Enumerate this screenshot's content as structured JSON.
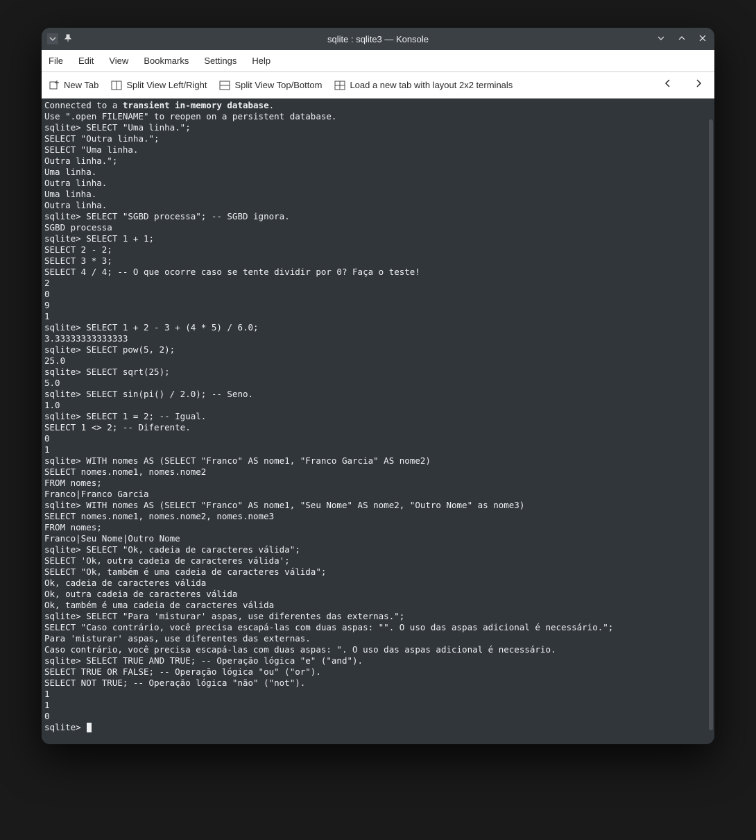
{
  "titlebar": {
    "title": "sqlite : sqlite3 — Konsole"
  },
  "menubar": {
    "items": [
      "File",
      "Edit",
      "View",
      "Bookmarks",
      "Settings",
      "Help"
    ]
  },
  "toolbar": {
    "new_tab": "New Tab",
    "split_lr": "Split View Left/Right",
    "split_tb": "Split View Top/Bottom",
    "load_layout": "Load a new tab with layout 2x2 terminals"
  },
  "terminal": {
    "prompt": "sqlite> ",
    "lines": [
      {
        "t": "plain",
        "text": "Connected to a "
      },
      {
        "t": "line1_bold",
        "text": "transient in-memory database"
      },
      {
        "t": "line1_tail",
        "text": "."
      },
      {
        "t": "l2",
        "text": "Use \".open FILENAME\" to reopen on a persistent database."
      },
      {
        "t": "l3",
        "text": "sqlite> SELECT \"Uma linha.\";"
      },
      {
        "t": "l4",
        "text": "SELECT \"Outra linha.\";"
      },
      {
        "t": "l5",
        "text": "SELECT \"Uma linha."
      },
      {
        "t": "l6",
        "text": "Outra linha.\";"
      },
      {
        "t": "l7",
        "text": "Uma linha."
      },
      {
        "t": "l8",
        "text": "Outra linha."
      },
      {
        "t": "l9",
        "text": "Uma linha."
      },
      {
        "t": "l10",
        "text": "Outra linha."
      },
      {
        "t": "l11",
        "text": "sqlite> SELECT \"SGBD processa\"; -- SGBD ignora."
      },
      {
        "t": "l12",
        "text": "SGBD processa"
      },
      {
        "t": "l13",
        "text": "sqlite> SELECT 1 + 1;"
      },
      {
        "t": "l14",
        "text": "SELECT 2 - 2;"
      },
      {
        "t": "l15",
        "text": "SELECT 3 * 3;"
      },
      {
        "t": "l16",
        "text": "SELECT 4 / 4; -- O que ocorre caso se tente dividir por 0? Faça o teste!"
      },
      {
        "t": "l17",
        "text": "2"
      },
      {
        "t": "l18",
        "text": "0"
      },
      {
        "t": "l19",
        "text": "9"
      },
      {
        "t": "l20",
        "text": "1"
      },
      {
        "t": "l21",
        "text": "sqlite> SELECT 1 + 2 - 3 + (4 * 5) / 6.0;"
      },
      {
        "t": "l22",
        "text": "3.33333333333333"
      },
      {
        "t": "l23",
        "text": "sqlite> SELECT pow(5, 2);"
      },
      {
        "t": "l24",
        "text": "25.0"
      },
      {
        "t": "l25",
        "text": "sqlite> SELECT sqrt(25);"
      },
      {
        "t": "l26",
        "text": "5.0"
      },
      {
        "t": "l27",
        "text": "sqlite> SELECT sin(pi() / 2.0); -- Seno."
      },
      {
        "t": "l28",
        "text": "1.0"
      },
      {
        "t": "l29",
        "text": "sqlite> SELECT 1 = 2; -- Igual."
      },
      {
        "t": "l30",
        "text": "SELECT 1 <> 2; -- Diferente."
      },
      {
        "t": "l31",
        "text": "0"
      },
      {
        "t": "l32",
        "text": "1"
      },
      {
        "t": "l33",
        "text": "sqlite> WITH nomes AS (SELECT \"Franco\" AS nome1, \"Franco Garcia\" AS nome2)"
      },
      {
        "t": "l34",
        "text": "SELECT nomes.nome1, nomes.nome2"
      },
      {
        "t": "l35",
        "text": "FROM nomes;"
      },
      {
        "t": "l36",
        "text": "Franco|Franco Garcia"
      },
      {
        "t": "l37",
        "text": "sqlite> WITH nomes AS (SELECT \"Franco\" AS nome1, \"Seu Nome\" AS nome2, \"Outro Nome\" as nome3)"
      },
      {
        "t": "l38",
        "text": "SELECT nomes.nome1, nomes.nome2, nomes.nome3"
      },
      {
        "t": "l39",
        "text": "FROM nomes;"
      },
      {
        "t": "l40",
        "text": "Franco|Seu Nome|Outro Nome"
      },
      {
        "t": "l41",
        "text": "sqlite> SELECT \"Ok, cadeia de caracteres válida\";"
      },
      {
        "t": "l42",
        "text": "SELECT 'Ok, outra cadeia de caracteres válida';"
      },
      {
        "t": "l43",
        "text": "SELECT \"Ok, também é uma cadeia de caracteres válida\";"
      },
      {
        "t": "l44",
        "text": "Ok, cadeia de caracteres válida"
      },
      {
        "t": "l45",
        "text": "Ok, outra cadeia de caracteres válida"
      },
      {
        "t": "l46",
        "text": "Ok, também é uma cadeia de caracteres válida"
      },
      {
        "t": "l47",
        "text": "sqlite> SELECT \"Para 'misturar' aspas, use diferentes das externas.\";"
      },
      {
        "t": "l48",
        "text": "SELECT \"Caso contrário, você precisa escapá-las com duas aspas: \"\". O uso das aspas adicional é necessário.\";"
      },
      {
        "t": "l49",
        "text": "Para 'misturar' aspas, use diferentes das externas."
      },
      {
        "t": "l50",
        "text": "Caso contrário, você precisa escapá-las com duas aspas: \". O uso das aspas adicional é necessário."
      },
      {
        "t": "l51",
        "text": "sqlite> SELECT TRUE AND TRUE; -- Operação lógica \"e\" (\"and\")."
      },
      {
        "t": "l52",
        "text": "SELECT TRUE OR FALSE; -- Operação lógica \"ou\" (\"or\")."
      },
      {
        "t": "l53",
        "text": "SELECT NOT TRUE; -- Operação lógica \"não\" (\"not\")."
      },
      {
        "t": "l54",
        "text": "1"
      },
      {
        "t": "l55",
        "text": "1"
      },
      {
        "t": "l56",
        "text": "0"
      }
    ]
  }
}
